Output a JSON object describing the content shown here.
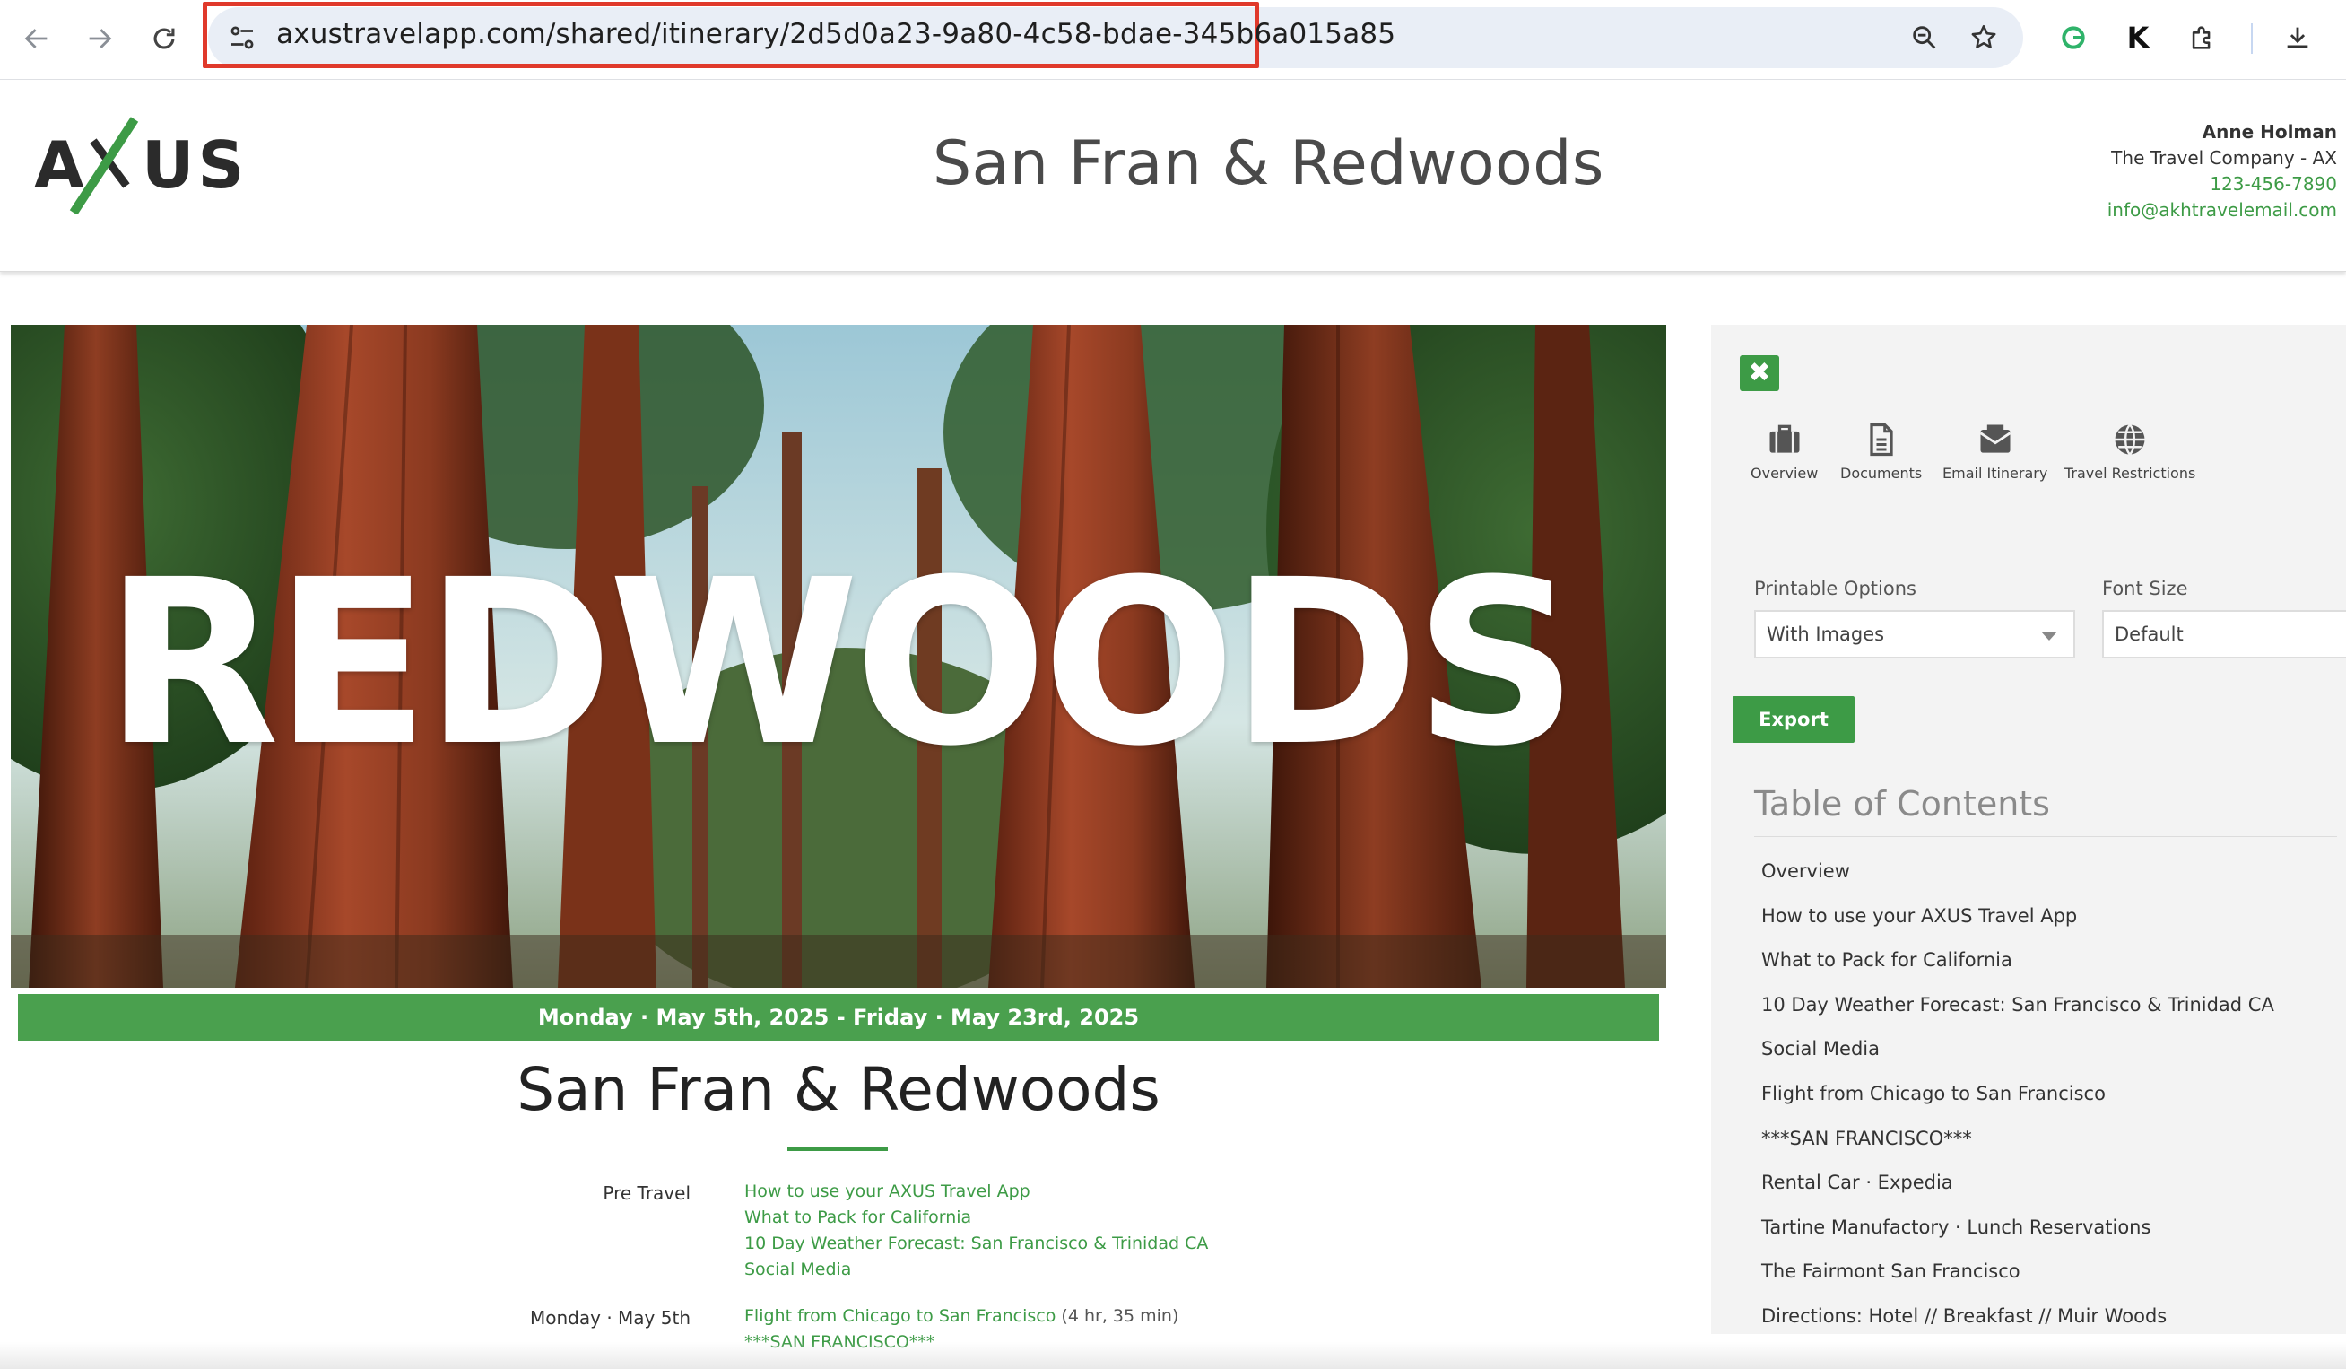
{
  "browser": {
    "url": "axustravelapp.com/shared/itinerary/2d5d0a23-9a80-4c58-bdae-345b6a015a85",
    "highlight_color": "#e0392b"
  },
  "header": {
    "logo_text": "AXUS",
    "title": "San Fran & Redwoods",
    "agent": {
      "name": "Anne Holman",
      "company": "The Travel Company - AX",
      "phone": "123-456-7890",
      "email": "info@akhtravelemail.com"
    }
  },
  "hero": {
    "overlay_word": "REDWOODS",
    "date_range": "Monday · May 5th, 2025 - Friday · May 23rd, 2025",
    "trip_title": "San Fran & Redwoods"
  },
  "agenda": [
    {
      "label": "Pre Travel",
      "items": [
        {
          "text": "How to use your AXUS Travel App"
        },
        {
          "text": "What to Pack for California"
        },
        {
          "text": "10 Day Weather Forecast: San Francisco & Trinidad CA"
        },
        {
          "text": "Social Media"
        }
      ]
    },
    {
      "label": "Monday · May 5th",
      "items": [
        {
          "text": "Flight from Chicago to San Francisco",
          "duration": "(4 hr, 35 min)"
        },
        {
          "text": "***SAN FRANCISCO***"
        }
      ]
    }
  ],
  "sidebar": {
    "close_icon_glyph": "✖",
    "tools": [
      {
        "label": "Overview",
        "icon": "briefcase-icon"
      },
      {
        "label": "Documents",
        "icon": "document-icon"
      },
      {
        "label": "Email Itinerary",
        "icon": "envelope-icon"
      },
      {
        "label": "Travel Restrictions",
        "icon": "globe-icon"
      }
    ],
    "printable_options_label": "Printable Options",
    "printable_options_value": "With Images",
    "font_size_label": "Font Size",
    "font_size_value": "Default",
    "export_label": "Export",
    "toc_title": "Table of Contents",
    "toc": [
      "Overview",
      "How to use your AXUS Travel App",
      "What to Pack for California",
      "10 Day Weather Forecast: San Francisco & Trinidad CA",
      "Social Media",
      "Flight from Chicago to San Francisco",
      "***SAN FRANCISCO***",
      "Rental Car · Expedia",
      "Tartine Manufactory · Lunch Reservations",
      "The Fairmont San Francisco",
      "Directions: Hotel // Breakfast // Muir Woods"
    ]
  },
  "colors": {
    "brand_green": "#3d9b46",
    "date_bar": "#4aa04e",
    "sidebar_bg": "#f3f3f3"
  }
}
